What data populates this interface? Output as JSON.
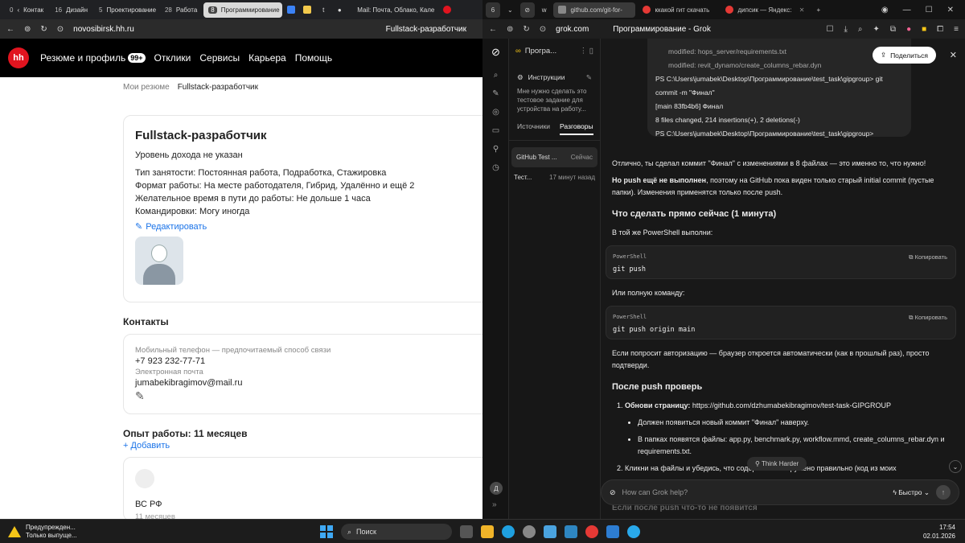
{
  "left_browser": {
    "tabs": [
      {
        "count": "0",
        "label": "Контак"
      },
      {
        "count": "16",
        "label": "Дизайн"
      },
      {
        "count": "5",
        "label": "Проектирование"
      },
      {
        "count": "28",
        "label": "Работа"
      },
      {
        "count": "8",
        "label": "Программирование",
        "active": true
      }
    ],
    "extra_tab_label": "Mail: Почта, Облако, Кале",
    "url": "novosibirsk.hh.ru",
    "page_title": "Fullstack-разработчик"
  },
  "hh": {
    "logo": "hh",
    "nav": [
      "Резюме и профиль",
      "Отклики",
      "Сервисы",
      "Карьера",
      "Помощь"
    ],
    "nav_badge": "99+",
    "breadcrumb": [
      "Мои резюме",
      "Fullstack-разработчик"
    ],
    "resume": {
      "title": "Fullstack-разработчик",
      "salary": "Уровень дохода не указан",
      "lines": [
        "Тип занятости: Постоянная работа, Подработка, Стажировка",
        "Формат работы: На месте работодателя, Гибрид, Удалённо и ещё 2",
        "Желательное время в пути до работы: Не дольше 1 часа",
        "Командировки: Могу иногда"
      ],
      "edit_label": "Редактировать"
    },
    "contacts": {
      "heading": "Контакты",
      "phone_label": "Мобильный телефон — предпочитаемый способ связи",
      "phone": "+7 923 232-77-71",
      "email_label": "Электронная почта",
      "email": "jumabekibragimov@mail.ru"
    },
    "experience": {
      "heading": "Опыт работы: 11 месяцев",
      "add_label": "+ Добавить",
      "org": "ВС РФ",
      "period": "11 месяцев"
    }
  },
  "right_browser": {
    "tabs": [
      "github.com/git-for-",
      "ккакой гит скачать",
      "дипсик — Яндекс:"
    ],
    "url": "grok.com",
    "page_title": "Программирование - Grok"
  },
  "grok": {
    "project_title": "Програ...",
    "instructions_label": "Инструкции",
    "instructions_text": "Мне нужно сделать это тестовое задание для устройства на работу...",
    "side_tabs": [
      "Источники",
      "Разговоры"
    ],
    "conversations": [
      {
        "title": "GitHub Test ...",
        "time": "Сейчас"
      },
      {
        "title": "Тест...",
        "time": "17 минут назад"
      }
    ],
    "user_initial": "Д",
    "share_label": "Поделиться",
    "terminal": [
      {
        "text": "modified:  hops_server/requirements.txt",
        "modified": true
      },
      {
        "text": "modified:  revit_dynamo/create_columns_rebar.dyn",
        "modified": true
      },
      {
        "text": "PS C:\\Users\\jumabek\\Desktop\\Программирование\\test_task\\gipgroup> git commit -m \"Финал\""
      },
      {
        "text": "[main 83fb4b6] Финал"
      },
      {
        "text": " 8 files changed, 214 insertions(+), 2 deletions(-)"
      },
      {
        "text": "PS C:\\Users\\jumabek\\Desktop\\Программирование\\test_task\\gipgroup>"
      }
    ],
    "msg_p1": "Отлично, ты сделал коммит \"Финал\" с изменениями в 8 файлах — это именно то, что нужно!",
    "msg_p2_bold": "Но push ещё не выполнен",
    "msg_p2_rest": ", поэтому на GitHub пока виден только старый initial commit (пустые папки). Изменения применятся только после push.",
    "h_now": "Что сделать прямо сейчас (1 минута)",
    "p_ps": "В той же PowerShell выполни:",
    "code1": {
      "lang": "PowerShell",
      "copy": "Копировать",
      "code": "git push"
    },
    "p_full": "Или полную команду:",
    "code2": {
      "lang": "PowerShell",
      "copy": "Копировать",
      "code": "git push origin main"
    },
    "p_auth": "Если попросит авторизацию — браузер откроется автоматически (как в прошлый раз), просто подтверди.",
    "h_after": "После push проверь",
    "step1_bold": "Обнови страницу:",
    "step1_link": "https://github.com/dzhumabekibragimov/test-task-GIPGROUP",
    "bullet1": "Должен появиться новый коммит \"Финал\" наверху.",
    "bullet2": "В папках появятся файлы: app.py, benchmark.py, workflow.mmd, create_columns_rebar.dyn и requirements.txt.",
    "step2": "Кликни на файлы и убедись, что содержимое загружено правильно (код из моих",
    "think_label": "Think Harder",
    "input_placeholder": "How can Grok help?",
    "mode_label": "Быстро",
    "fade_heading": "Если после push что-то не появится"
  },
  "taskbar": {
    "warning_title": "Предупрежден...",
    "warning_sub": "Только выпуще...",
    "search_label": "Поиск",
    "time": "17:54",
    "date": "02.01.2026"
  },
  "colors": {
    "hh_red": "#e1141f",
    "link_blue": "#1a73e8",
    "grok_bg": "#181818"
  }
}
